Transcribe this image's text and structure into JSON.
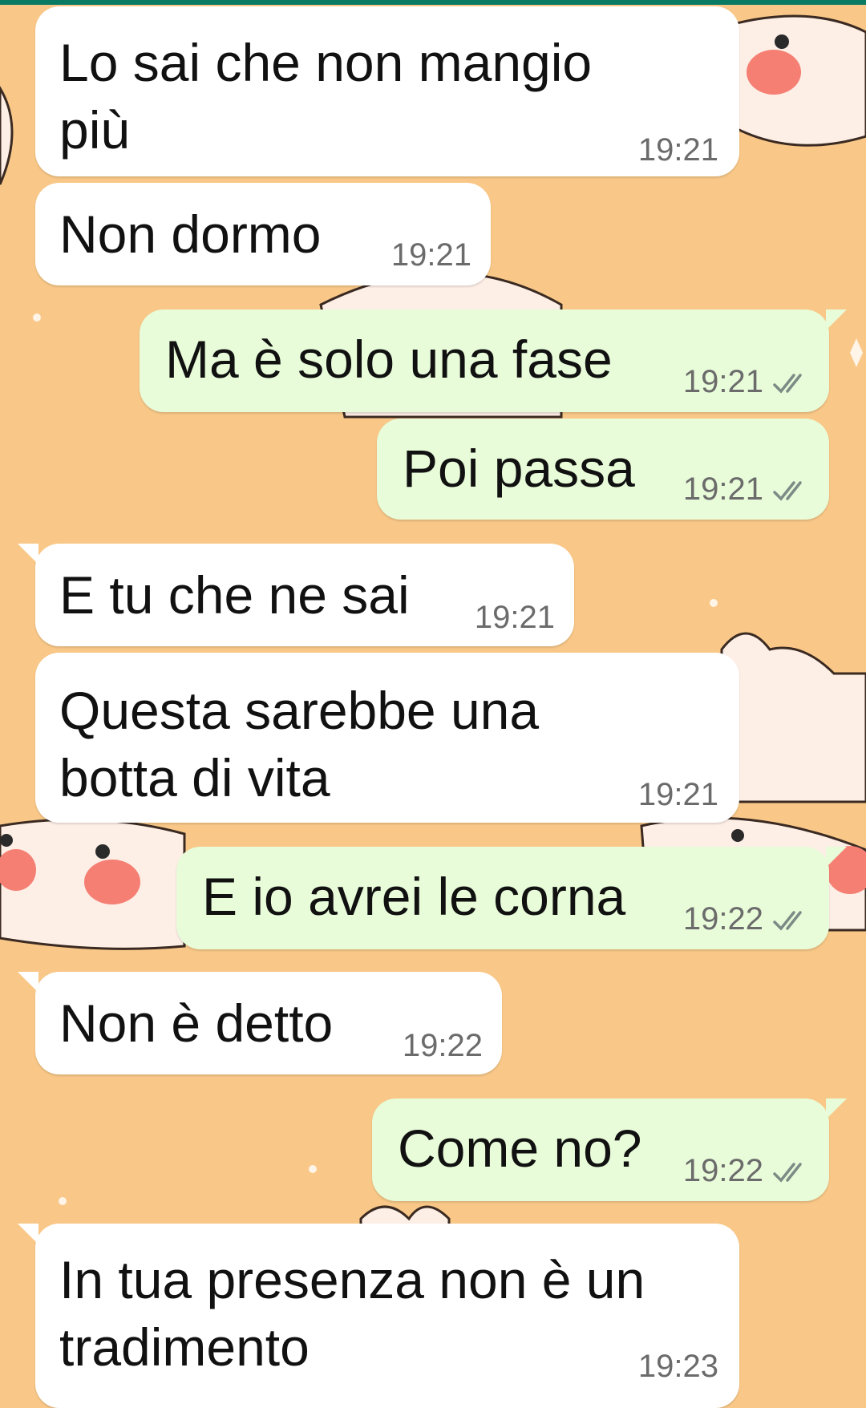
{
  "conversation": {
    "messages": [
      {
        "direction": "incoming",
        "text": "Lo sai che non mangio\npiù",
        "time": "19:21"
      },
      {
        "direction": "incoming",
        "text": "Non dormo",
        "time": "19:21"
      },
      {
        "direction": "outgoing",
        "text": "Ma è solo una fase",
        "time": "19:21",
        "status": "read-check-icon"
      },
      {
        "direction": "outgoing",
        "text": "Poi passa",
        "time": "19:21",
        "status": "read-check-icon"
      },
      {
        "direction": "incoming",
        "text": "E tu che ne sai",
        "time": "19:21"
      },
      {
        "direction": "incoming",
        "text": "Questa sarebbe una\nbotta di vita",
        "time": "19:21"
      },
      {
        "direction": "outgoing",
        "text": "E io avrei le corna",
        "time": "19:22",
        "status": "read-check-icon"
      },
      {
        "direction": "incoming",
        "text": "Non è detto",
        "time": "19:22"
      },
      {
        "direction": "outgoing",
        "text": "Come no?",
        "time": "19:22",
        "status": "read-check-icon"
      },
      {
        "direction": "incoming",
        "text": "In tua presenza non è un\ntradimento",
        "time": "19:23"
      }
    ]
  },
  "colors": {
    "wallpaper": "#f9c888",
    "incoming_bubble": "#ffffff",
    "outgoing_bubble": "#e8fcd9",
    "header_accent": "#0b7a63",
    "timestamp": "#6b6b6b"
  }
}
